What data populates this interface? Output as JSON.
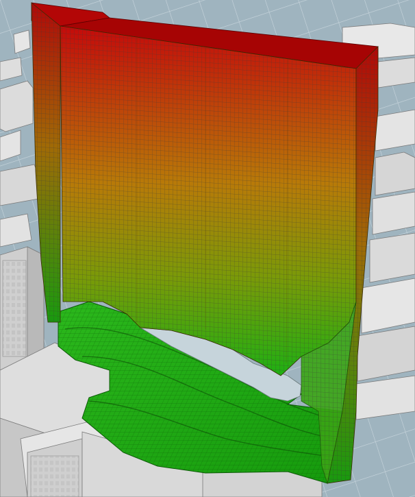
{
  "scene": {
    "type": "3d-voxel-volume-over-city-model",
    "colors": {
      "ground": "#9fb4bf",
      "ground_grid": "#c9d6dd",
      "buildings_top": "#ededed",
      "buildings_side": "#c8c8c8",
      "buildings_edge": "#7a7a7a",
      "volume_top": "#c40a0a",
      "volume_mid": "#b87a08",
      "volume_bottom": "#1eb012",
      "voxel_lines": "#3a3a3a"
    }
  }
}
